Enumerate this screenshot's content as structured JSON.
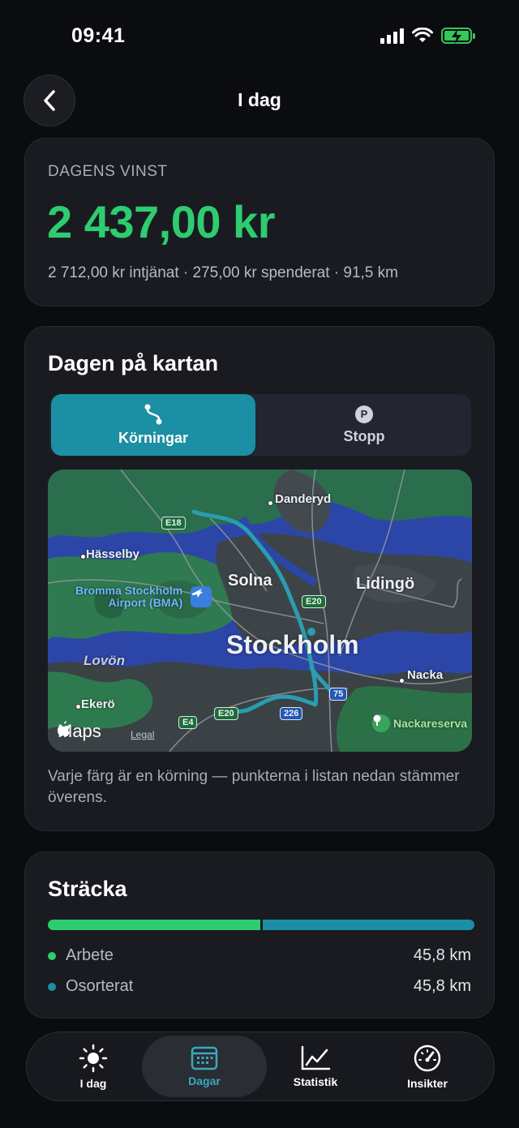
{
  "status_bar": {
    "time": "09:41"
  },
  "nav": {
    "title": "I dag"
  },
  "profit": {
    "label": "DAGENS VINST",
    "value": "2 437,00 kr",
    "summary": "2 712,00 kr intjänat · 275,00 kr spenderat · 91,5 km"
  },
  "map_card": {
    "title": "Dagen på kartan",
    "segments": [
      {
        "label": "Körningar",
        "icon": "route-icon",
        "selected": true
      },
      {
        "label": "Stopp",
        "icon": "parking-icon",
        "selected": false
      }
    ],
    "map": {
      "labels": {
        "danderyd": "Danderyd",
        "hasselby": "Hässelby",
        "bromma": "Bromma Stockholm",
        "bromma2": "Airport (BMA)",
        "solna": "Solna",
        "lidingo": "Lidingö",
        "stockholm": "Stockholm",
        "lovon": "Lovön",
        "nacka": "Nacka",
        "ekero": "Ekerö",
        "nackareserv": "Nackareserva"
      },
      "shields": {
        "e18": "E18",
        "e20a": "E20",
        "e20b": "E20",
        "e4": "E4",
        "r75": "75",
        "r226": "226"
      },
      "brand": "Maps",
      "legal": "Legal",
      "route_color": "#2a9db0"
    },
    "note": "Varje färg är en körning — punkterna i listan nedan stämmer överens."
  },
  "distance": {
    "title": "Sträcka",
    "work_fraction": 0.5,
    "items": [
      {
        "name": "Arbete",
        "value": "45,8 km",
        "color": "#2ecc71"
      },
      {
        "name": "Osorterat",
        "value": "45,8 km",
        "color": "#1b8fa3"
      }
    ]
  },
  "tab_bar": {
    "tabs": [
      {
        "label": "I dag",
        "icon": "sun-icon"
      },
      {
        "label": "Dagar",
        "icon": "calendar-icon",
        "active": true
      },
      {
        "label": "Statistik",
        "icon": "chart-icon"
      },
      {
        "label": "Insikter",
        "icon": "gauge-icon"
      }
    ]
  },
  "colors": {
    "accent_green": "#2ecc71",
    "accent_teal": "#1b8fa3",
    "background": "#0b0c10"
  }
}
